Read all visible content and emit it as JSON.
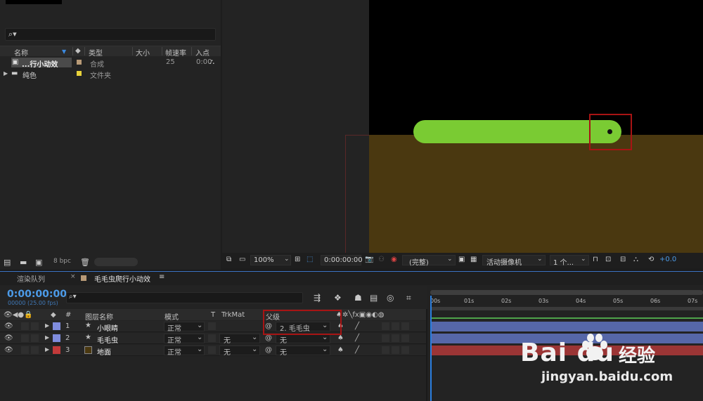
{
  "project": {
    "headers": {
      "name": "名称",
      "type": "类型",
      "size": "大小",
      "fps": "帧速率",
      "in": "入点"
    },
    "items": [
      {
        "name": "...行小动效",
        "type": "合成",
        "fps": "25",
        "in": "0:00",
        "swatch": "#b89a77"
      },
      {
        "name": "纯色",
        "type": "文件夹",
        "fps": "",
        "in": "",
        "swatch": "#e8d23a"
      }
    ],
    "footer_bpc": "8 bpc"
  },
  "viewer": {
    "zoom": "100%",
    "timecode": "0:00:00:00",
    "resolution": "(完整)",
    "camera": "活动摄像机",
    "views": "1 个...",
    "exposure": "+0.0",
    "colors": {
      "ground": "#4a3810",
      "caterpillar": "#7acb33",
      "highlight": "#a71414"
    }
  },
  "timeline": {
    "tabs": {
      "render_queue": "渲染队列",
      "comp": "毛毛虫爬行小动效"
    },
    "timecode": "0:00:00:00",
    "fps": "00000 (25.00 fps)",
    "headers": {
      "num": "#",
      "layer_name": "图层名称",
      "mode": "模式",
      "t": "T",
      "trkmat": "TrkMat",
      "parent": "父级"
    },
    "ruler": [
      "00s",
      "01s",
      "02s",
      "03s",
      "04s",
      "05s",
      "06s",
      "07s"
    ],
    "layers": [
      {
        "num": "1",
        "name": "小眼睛",
        "mode": "正常",
        "trkmat": "",
        "parent": "2. 毛毛虫",
        "color": "#7f8cdd",
        "bar": "#5667a8"
      },
      {
        "num": "2",
        "name": "毛毛虫",
        "mode": "正常",
        "trkmat": "无",
        "parent": "无",
        "color": "#7f8cdd",
        "bar": "#5667a8"
      },
      {
        "num": "3",
        "name": "地面",
        "mode": "正常",
        "trkmat": "无",
        "parent": "无",
        "color": "#c23a3a",
        "bar": "#9b3535"
      }
    ]
  },
  "watermark": {
    "logo": "Bai du",
    "cn": "经验",
    "url": "jingyan.baidu.com"
  }
}
